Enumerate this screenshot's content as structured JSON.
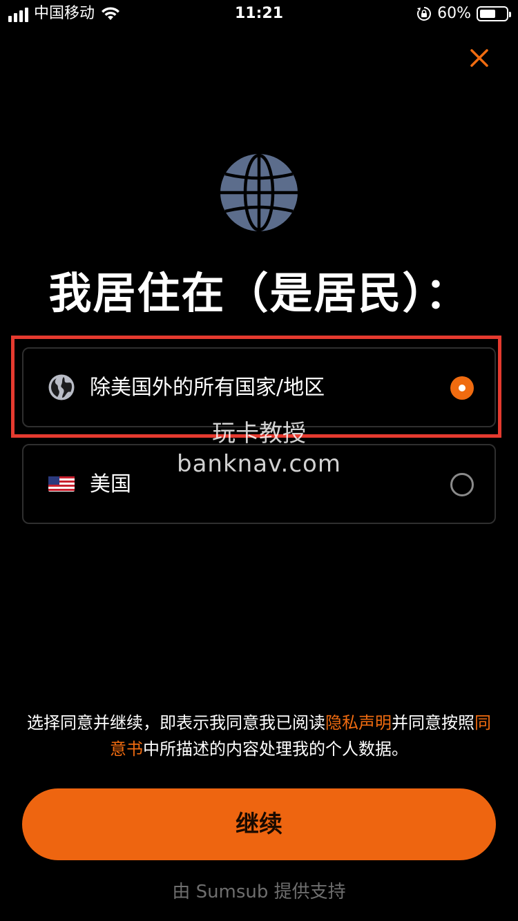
{
  "status_bar": {
    "carrier": "中国移动",
    "time": "11:21",
    "battery_percent_text": "60%",
    "battery_level": 0.6
  },
  "title": "我居住在（是居民）：",
  "options": [
    {
      "label": "除美国外的所有国家/地区",
      "icon": "globe-icon",
      "selected": true
    },
    {
      "label": "美国",
      "icon": "us-flag-icon",
      "selected": false
    }
  ],
  "watermark": {
    "line1": "玩卡教授",
    "line2": "banknav.com"
  },
  "consent": {
    "part1": "选择同意并继续，即表示我同意我已阅读",
    "privacy_link": "隐私声明",
    "part2": "并同意按照",
    "agreement_link": "同意书",
    "part3": "中所描述的内容处理我的个人数据。"
  },
  "continue_button": "继续",
  "powered_by": "由 Sumsub 提供支持",
  "colors": {
    "accent": "#f06b10",
    "button": "#ee6510",
    "highlight": "#e53a2f",
    "globe": "#5c6d8c"
  }
}
